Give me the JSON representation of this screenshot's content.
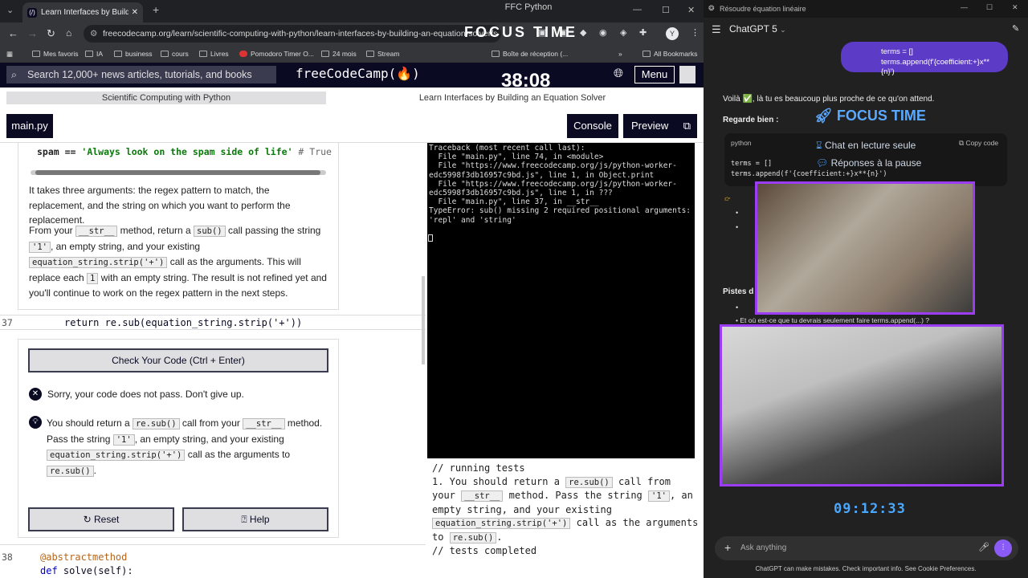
{
  "browser": {
    "tab_title": "Learn Interfaces by Building an",
    "window_title": "FFC Python",
    "url": "freecodecamp.org/learn/scientific-computing-with-python/learn-interfaces-by-building-an-equation-solver/s",
    "focus_overlay": "FOCUS TIME",
    "bookmarks": [
      "Mes favoris",
      "IA",
      "business",
      "cours",
      "Livres",
      "Pomodoro Timer O...",
      "24 mois",
      "Stream",
      "Boîte de réception (...",
      "All Bookmarks"
    ]
  },
  "fcc": {
    "search_placeholder": "Search 12,000+ news articles, tutorials, and books",
    "logo": "freeCodeCamp(🔥)",
    "timer": "38:08",
    "menu": "Menu",
    "breadcrumb_1": "Scientific Computing with Python",
    "breadcrumb_2": "Learn Interfaces by Building an Equation Solver",
    "file_tab": "main.py",
    "console_btn": "Console",
    "preview_btn": "Preview"
  },
  "instructions": {
    "code_example_a": "spam == ",
    "code_example_b": "'Always look on the spam side of life'",
    "code_example_c": " # True",
    "p1": "It takes three arguments: the regex pattern to match, the replacement, and the string on which you want to perform the replacement.",
    "p2_a": "From your ",
    "p2_str": "__str__",
    "p2_b": " method, return a ",
    "p2_sub": "sub()",
    "p2_c": " call passing the string",
    "p2_one": "'1'",
    "p2_d": ", an empty string, and your existing",
    "p2_strip": "equation_string.strip('+')",
    "p2_e": " call as the arguments. This will",
    "p2_f": "replace each ",
    "p2_one2": "1",
    "p2_g": " with an empty string. The result is not refined yet and",
    "p2_h": "you'll continue to work on the regex pattern in the next steps."
  },
  "editor": {
    "line37_num": "37",
    "line37_code": "return re.sub(equation_string.strip('+'))",
    "line38_num": "38",
    "line38_code": "@abstractmethod",
    "line39_code_kw": "def ",
    "line39_code": "solve(self):"
  },
  "check": {
    "check_btn": "Check Your Code (Ctrl + Enter)",
    "fail_msg": "Sorry, your code does not pass. Don't give up.",
    "hint_a": "You should return a ",
    "hint_sub": "re.sub()",
    "hint_b": " call from your ",
    "hint_str": "__str__",
    "hint_c": " method.",
    "hint_d": "Pass the string ",
    "hint_one": "'1'",
    "hint_e": ", an empty string, and your existing",
    "hint_strip": "equation_string.strip('+')",
    "hint_f": " call as the arguments to",
    "hint_resub": "re.sub()",
    "hint_g": ".",
    "reset_btn": "Reset",
    "help_btn": "Help"
  },
  "console_output": "Traceback (most recent call last):\n  File \"main.py\", line 74, in <module>\n  File \"https://www.freecodecamp.org/js/python-worker-edc5998f3db16957c9bd.js\", line 1, in Object.print\n  File \"https://www.freecodecamp.org/js/python-worker-edc5998f3db16957c9bd.js\", line 1, in ???\n  File \"main.py\", line 37, in __str__\nTypeError: sub() missing 2 required positional arguments: 'repl' and 'string'",
  "tests": {
    "running": "// running tests",
    "t1_a": "1. You should return a ",
    "t1_resub": "re.sub()",
    "t1_b": " call from your ",
    "t1_str": "__str__",
    "t1_c": " method. Pass the string ",
    "t1_one": "'1'",
    "t1_d": ", an empty string, and your existing ",
    "t1_strip": "equation_string.strip('+')",
    "t1_e": " call as the arguments to ",
    "t1_resub2": "re.sub()",
    "t1_f": ".",
    "completed": "// tests completed"
  },
  "chatgpt": {
    "window_title": "Résoudre équation linéaire",
    "model": "ChatGPT 5",
    "user_line1": "terms = []",
    "user_line2": "terms.append(f'{coefficient:+}x**{n}')",
    "reply_1": "Voilà ✅, là tu es beaucoup plus proche de ce qu'on attend.",
    "reply_2": "Regarde bien :",
    "focus_label": "FOCUS TIME",
    "lang": "python",
    "copy": "Copy code",
    "chat_readonly": "Chat en lecture seule",
    "pause_answers": "Réponses à la pause",
    "code_1": "terms = []",
    "code_2": "terms.append(f'{coefficient:+}x**{n}')",
    "pistes": "Pistes d",
    "bullet_last": "Et où est-ce que tu devrais seulement faire terms.append(...) ?",
    "clock": "09:12:33",
    "ask_placeholder": "Ask anything",
    "disclaimer": "ChatGPT can make mistakes. Check important info. See Cookie Preferences."
  }
}
